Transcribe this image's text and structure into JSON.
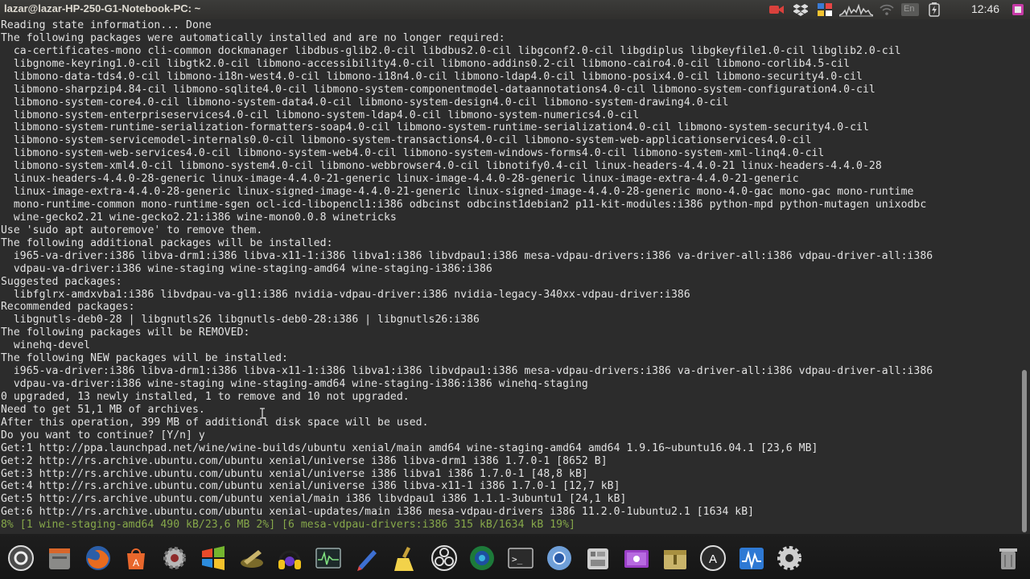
{
  "window": {
    "title": "lazar@lazar-HP-250-G1-Notebook-PC: ~"
  },
  "topbar": {
    "clock": "12:46",
    "keyboard_indicator": "En",
    "icons": [
      "record-icon",
      "dropbox-icon",
      "apps-grid-icon",
      "system-monitor-graph-icon",
      "wifi-icon",
      "keyboard-layout-icon",
      "battery-icon",
      "power-icon"
    ]
  },
  "terminal": {
    "lines": [
      "Reading state information... Done",
      "The following packages were automatically installed and are no longer required:",
      "  ca-certificates-mono cli-common dockmanager libdbus-glib2.0-cil libdbus2.0-cil libgconf2.0-cil libgdiplus libgkeyfile1.0-cil libglib2.0-cil",
      "  libgnome-keyring1.0-cil libgtk2.0-cil libmono-accessibility4.0-cil libmono-addins0.2-cil libmono-cairo4.0-cil libmono-corlib4.5-cil",
      "  libmono-data-tds4.0-cil libmono-i18n-west4.0-cil libmono-i18n4.0-cil libmono-ldap4.0-cil libmono-posix4.0-cil libmono-security4.0-cil",
      "  libmono-sharpzip4.84-cil libmono-sqlite4.0-cil libmono-system-componentmodel-dataannotations4.0-cil libmono-system-configuration4.0-cil",
      "  libmono-system-core4.0-cil libmono-system-data4.0-cil libmono-system-design4.0-cil libmono-system-drawing4.0-cil",
      "  libmono-system-enterpriseservices4.0-cil libmono-system-ldap4.0-cil libmono-system-numerics4.0-cil",
      "  libmono-system-runtime-serialization-formatters-soap4.0-cil libmono-system-runtime-serialization4.0-cil libmono-system-security4.0-cil",
      "  libmono-system-servicemodel-internals0.0-cil libmono-system-transactions4.0-cil libmono-system-web-applicationservices4.0-cil",
      "  libmono-system-web-services4.0-cil libmono-system-web4.0-cil libmono-system-windows-forms4.0-cil libmono-system-xml-linq4.0-cil",
      "  libmono-system-xml4.0-cil libmono-system4.0-cil libmono-webbrowser4.0-cil libnotify0.4-cil linux-headers-4.4.0-21 linux-headers-4.4.0-28",
      "  linux-headers-4.4.0-28-generic linux-image-4.4.0-21-generic linux-image-4.4.0-28-generic linux-image-extra-4.4.0-21-generic",
      "  linux-image-extra-4.4.0-28-generic linux-signed-image-4.4.0-21-generic linux-signed-image-4.4.0-28-generic mono-4.0-gac mono-gac mono-runtime",
      "  mono-runtime-common mono-runtime-sgen ocl-icd-libopencl1:i386 odbcinst odbcinst1debian2 p11-kit-modules:i386 python-mpd python-mutagen unixodbc",
      "  wine-gecko2.21 wine-gecko2.21:i386 wine-mono0.0.8 winetricks",
      "Use 'sudo apt autoremove' to remove them.",
      "The following additional packages will be installed:",
      "  i965-va-driver:i386 libva-drm1:i386 libva-x11-1:i386 libva1:i386 libvdpau1:i386 mesa-vdpau-drivers:i386 va-driver-all:i386 vdpau-driver-all:i386",
      "  vdpau-va-driver:i386 wine-staging wine-staging-amd64 wine-staging-i386:i386",
      "Suggested packages:",
      "  libfglrx-amdxvba1:i386 libvdpau-va-gl1:i386 nvidia-vdpau-driver:i386 nvidia-legacy-340xx-vdpau-driver:i386",
      "Recommended packages:",
      "  libgnutls-deb0-28 | libgnutls26 libgnutls-deb0-28:i386 | libgnutls26:i386",
      "The following packages will be REMOVED:",
      "  winehq-devel",
      "The following NEW packages will be installed:",
      "  i965-va-driver:i386 libva-drm1:i386 libva-x11-1:i386 libva1:i386 libvdpau1:i386 mesa-vdpau-drivers:i386 va-driver-all:i386 vdpau-driver-all:i386",
      "  vdpau-va-driver:i386 wine-staging wine-staging-amd64 wine-staging-i386:i386 winehq-staging",
      "0 upgraded, 13 newly installed, 1 to remove and 10 not upgraded.",
      "Need to get 51,1 MB of archives.",
      "After this operation, 399 MB of additional disk space will be used.",
      "Do you want to continue? [Y/n] y",
      "Get:1 http://ppa.launchpad.net/wine/wine-builds/ubuntu xenial/main amd64 wine-staging-amd64 amd64 1.9.16~ubuntu16.04.1 [23,6 MB]",
      "Get:2 http://rs.archive.ubuntu.com/ubuntu xenial/universe i386 libva-drm1 i386 1.7.0-1 [8652 B]",
      "Get:3 http://rs.archive.ubuntu.com/ubuntu xenial/universe i386 libva1 i386 1.7.0-1 [48,8 kB]",
      "Get:4 http://rs.archive.ubuntu.com/ubuntu xenial/universe i386 libva-x11-1 i386 1.7.0-1 [12,7 kB]",
      "Get:5 http://rs.archive.ubuntu.com/ubuntu xenial/main i386 libvdpau1 i386 1.1.1-3ubuntu1 [24,1 kB]",
      "Get:6 http://rs.archive.ubuntu.com/ubuntu xenial-updates/main i386 mesa-vdpau-drivers i386 11.2.0-1ubuntu2.1 [1634 kB]"
    ],
    "progress_line": "8% [1 wine-staging-amd64 490 kB/23,6 MB 2%] [6 mesa-vdpau-drivers:i386 315 kB/1634 kB 19%]",
    "text_color": "#e2e2e2",
    "progress_color": "#86a84a",
    "background": "#2c2c2c"
  },
  "dock": {
    "items": [
      {
        "name": "ubuntu-settings-icon"
      },
      {
        "name": "file-manager-icon"
      },
      {
        "name": "firefox-icon"
      },
      {
        "name": "software-center-icon"
      },
      {
        "name": "wine-config-icon"
      },
      {
        "name": "windows-app-icon"
      },
      {
        "name": "playonlinux-icon"
      },
      {
        "name": "audio-headphones-icon"
      },
      {
        "name": "system-monitor-icon"
      },
      {
        "name": "pen-tool-icon"
      },
      {
        "name": "cleaner-broom-icon"
      },
      {
        "name": "obs-studio-icon"
      },
      {
        "name": "globe-icon"
      },
      {
        "name": "terminal-icon"
      },
      {
        "name": "chromium-icon"
      },
      {
        "name": "device-manager-icon"
      },
      {
        "name": "screen-recorder-icon"
      },
      {
        "name": "archive-manager-icon"
      },
      {
        "name": "update-manager-icon"
      },
      {
        "name": "activity-monitor-icon"
      },
      {
        "name": "gear-icon"
      },
      {
        "name": "trash-icon"
      }
    ]
  }
}
